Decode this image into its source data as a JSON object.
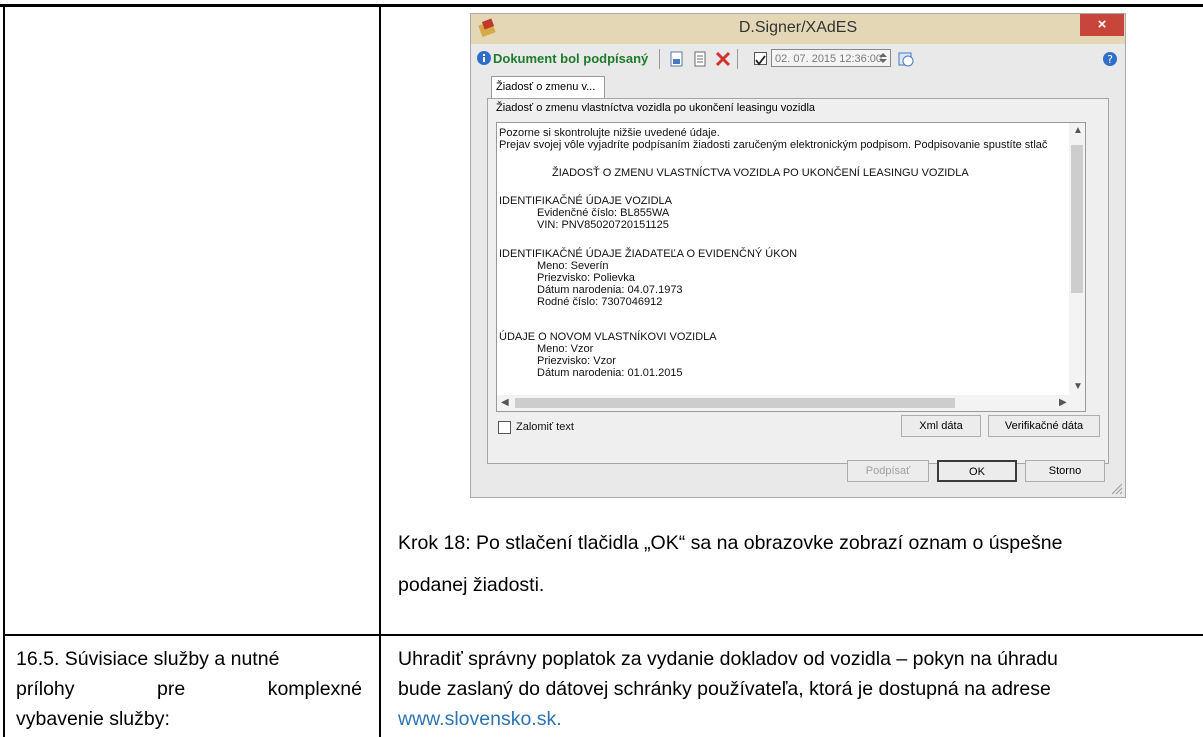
{
  "dialog": {
    "title": "D.Signer/XAdES",
    "close_label": "×",
    "toolbar": {
      "status": "Dokument bol podpísaný",
      "date_value": "02. 07. 2015 12:36:00"
    },
    "tab_label": "Žiadosť o zmenu v...",
    "panel_title": "Žiadosť o zmenu vlastníctva vozidla po ukončení leasingu vozidla",
    "text_lines": [
      "Pozorne si skontrolujte nižšie uvedené údaje.",
      "Prejav svojej vôle vyjadríte podpísaním žiadosti zaručeným elektronickým podpisom. Podpisovanie spustíte stlač",
      "ŽIADOSŤ O ZMENU VLASTNÍCTVA VOZIDLA PO UKONČENÍ LEASINGU VOZIDLA",
      "IDENTIFIKAČNÉ ÚDAJE VOZIDLA",
      "Evidenčné číslo: BL855WA",
      "VIN: PNV85020720151125",
      "IDENTIFIKAČNÉ ÚDAJE ŽIADATEĽA O EVIDENČNÝ ÚKON",
      "Meno: Severín",
      "Priezvisko: Polievka",
      "Dátum narodenia: 04.07.1973",
      "Rodné číslo: 7307046912",
      "ÚDAJE O NOVOM VLASTNÍKOVI VOZIDLA",
      "Meno: Vzor",
      "Priezvisko: Vzor",
      "Dátum narodenia: 01.01.2015"
    ],
    "wrap_label": "Zalomiť text",
    "xml_button": "Xml dáta",
    "verify_button": "Verifikačné dáta",
    "sign_button": "Podpísať",
    "ok_button": "OK",
    "cancel_button": "Storno"
  },
  "document": {
    "step_text_line1": "Krok 18: Po stlačení tlačidla „OK“ sa na obrazovke zobrazí oznam o úspešne",
    "step_text_line2": "podanej žiadosti.",
    "row_label_line1": "16.5. Súvisiace služby a nutné",
    "row_label_line2_a": "prílohy",
    "row_label_line2_b": "pre",
    "row_label_line2_c": "komplexné",
    "row_label_line3": "vybavenie služby:",
    "row_value_line1": "Uhradiť správny poplatok za vydanie dokladov od vozidla – pokyn na úhradu",
    "row_value_line2": "bude zaslaný do dátovej schránky používateľa, ktorá je dostupná na adrese",
    "row_value_link": "www.slovensko.sk."
  }
}
